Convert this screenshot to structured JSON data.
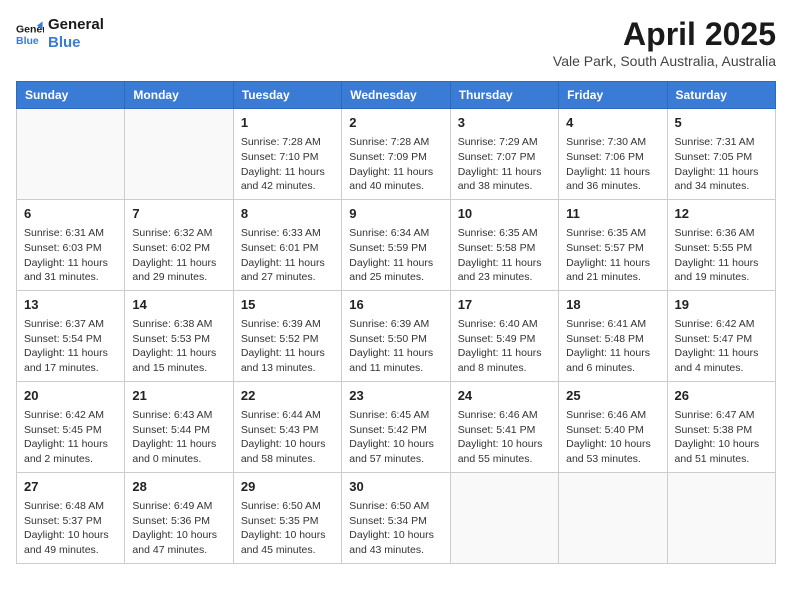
{
  "logo": {
    "line1": "General",
    "line2": "Blue"
  },
  "title": "April 2025",
  "location": "Vale Park, South Australia, Australia",
  "days_of_week": [
    "Sunday",
    "Monday",
    "Tuesday",
    "Wednesday",
    "Thursday",
    "Friday",
    "Saturday"
  ],
  "weeks": [
    [
      {
        "day": "",
        "info": ""
      },
      {
        "day": "",
        "info": ""
      },
      {
        "day": "1",
        "info": "Sunrise: 7:28 AM\nSunset: 7:10 PM\nDaylight: 11 hours and 42 minutes."
      },
      {
        "day": "2",
        "info": "Sunrise: 7:28 AM\nSunset: 7:09 PM\nDaylight: 11 hours and 40 minutes."
      },
      {
        "day": "3",
        "info": "Sunrise: 7:29 AM\nSunset: 7:07 PM\nDaylight: 11 hours and 38 minutes."
      },
      {
        "day": "4",
        "info": "Sunrise: 7:30 AM\nSunset: 7:06 PM\nDaylight: 11 hours and 36 minutes."
      },
      {
        "day": "5",
        "info": "Sunrise: 7:31 AM\nSunset: 7:05 PM\nDaylight: 11 hours and 34 minutes."
      }
    ],
    [
      {
        "day": "6",
        "info": "Sunrise: 6:31 AM\nSunset: 6:03 PM\nDaylight: 11 hours and 31 minutes."
      },
      {
        "day": "7",
        "info": "Sunrise: 6:32 AM\nSunset: 6:02 PM\nDaylight: 11 hours and 29 minutes."
      },
      {
        "day": "8",
        "info": "Sunrise: 6:33 AM\nSunset: 6:01 PM\nDaylight: 11 hours and 27 minutes."
      },
      {
        "day": "9",
        "info": "Sunrise: 6:34 AM\nSunset: 5:59 PM\nDaylight: 11 hours and 25 minutes."
      },
      {
        "day": "10",
        "info": "Sunrise: 6:35 AM\nSunset: 5:58 PM\nDaylight: 11 hours and 23 minutes."
      },
      {
        "day": "11",
        "info": "Sunrise: 6:35 AM\nSunset: 5:57 PM\nDaylight: 11 hours and 21 minutes."
      },
      {
        "day": "12",
        "info": "Sunrise: 6:36 AM\nSunset: 5:55 PM\nDaylight: 11 hours and 19 minutes."
      }
    ],
    [
      {
        "day": "13",
        "info": "Sunrise: 6:37 AM\nSunset: 5:54 PM\nDaylight: 11 hours and 17 minutes."
      },
      {
        "day": "14",
        "info": "Sunrise: 6:38 AM\nSunset: 5:53 PM\nDaylight: 11 hours and 15 minutes."
      },
      {
        "day": "15",
        "info": "Sunrise: 6:39 AM\nSunset: 5:52 PM\nDaylight: 11 hours and 13 minutes."
      },
      {
        "day": "16",
        "info": "Sunrise: 6:39 AM\nSunset: 5:50 PM\nDaylight: 11 hours and 11 minutes."
      },
      {
        "day": "17",
        "info": "Sunrise: 6:40 AM\nSunset: 5:49 PM\nDaylight: 11 hours and 8 minutes."
      },
      {
        "day": "18",
        "info": "Sunrise: 6:41 AM\nSunset: 5:48 PM\nDaylight: 11 hours and 6 minutes."
      },
      {
        "day": "19",
        "info": "Sunrise: 6:42 AM\nSunset: 5:47 PM\nDaylight: 11 hours and 4 minutes."
      }
    ],
    [
      {
        "day": "20",
        "info": "Sunrise: 6:42 AM\nSunset: 5:45 PM\nDaylight: 11 hours and 2 minutes."
      },
      {
        "day": "21",
        "info": "Sunrise: 6:43 AM\nSunset: 5:44 PM\nDaylight: 11 hours and 0 minutes."
      },
      {
        "day": "22",
        "info": "Sunrise: 6:44 AM\nSunset: 5:43 PM\nDaylight: 10 hours and 58 minutes."
      },
      {
        "day": "23",
        "info": "Sunrise: 6:45 AM\nSunset: 5:42 PM\nDaylight: 10 hours and 57 minutes."
      },
      {
        "day": "24",
        "info": "Sunrise: 6:46 AM\nSunset: 5:41 PM\nDaylight: 10 hours and 55 minutes."
      },
      {
        "day": "25",
        "info": "Sunrise: 6:46 AM\nSunset: 5:40 PM\nDaylight: 10 hours and 53 minutes."
      },
      {
        "day": "26",
        "info": "Sunrise: 6:47 AM\nSunset: 5:38 PM\nDaylight: 10 hours and 51 minutes."
      }
    ],
    [
      {
        "day": "27",
        "info": "Sunrise: 6:48 AM\nSunset: 5:37 PM\nDaylight: 10 hours and 49 minutes."
      },
      {
        "day": "28",
        "info": "Sunrise: 6:49 AM\nSunset: 5:36 PM\nDaylight: 10 hours and 47 minutes."
      },
      {
        "day": "29",
        "info": "Sunrise: 6:50 AM\nSunset: 5:35 PM\nDaylight: 10 hours and 45 minutes."
      },
      {
        "day": "30",
        "info": "Sunrise: 6:50 AM\nSunset: 5:34 PM\nDaylight: 10 hours and 43 minutes."
      },
      {
        "day": "",
        "info": ""
      },
      {
        "day": "",
        "info": ""
      },
      {
        "day": "",
        "info": ""
      }
    ]
  ]
}
